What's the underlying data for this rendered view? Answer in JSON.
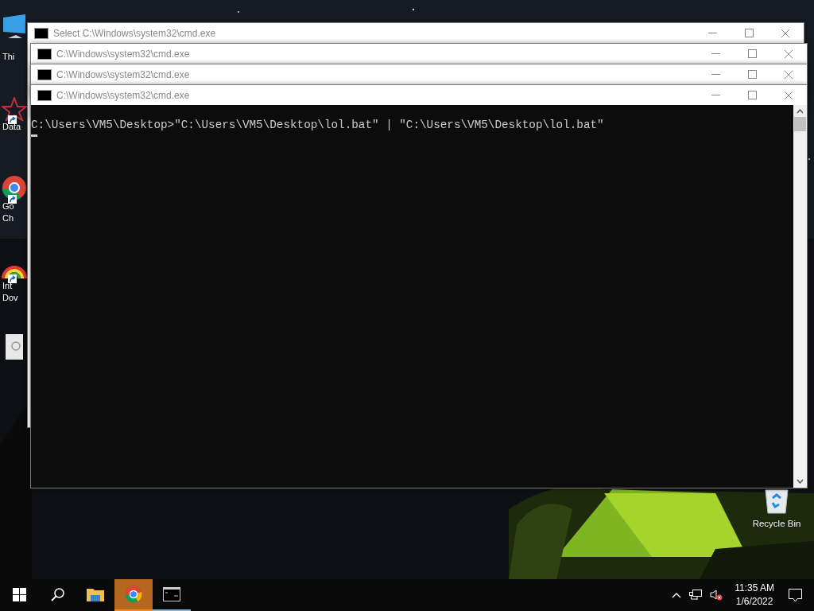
{
  "desktop_icons": [
    {
      "kind": "computer",
      "lines": [
        "Thi"
      ]
    },
    {
      "kind": "app",
      "lines": [
        "Data"
      ]
    },
    {
      "kind": "browser",
      "lines": [
        "Go",
        "Ch"
      ]
    },
    {
      "kind": "download",
      "lines": [
        "Int",
        "Dov"
      ]
    },
    {
      "kind": "document"
    },
    {
      "kind": "recycle",
      "lines": [
        "Recycle Bin"
      ]
    }
  ],
  "windows": [
    {
      "title": "Select C:\\Windows\\system32\\cmd.exe"
    },
    {
      "title": "C:\\Windows\\system32\\cmd.exe"
    },
    {
      "title": "C:\\Windows\\system32\\cmd.exe"
    },
    {
      "title": "C:\\Windows\\system32\\cmd.exe"
    }
  ],
  "console": {
    "lines": [
      "C:\\Users\\VM5\\Desktop>\"C:\\Users\\VM5\\Desktop\\lol.bat\" | \"C:\\Users\\VM5\\Desktop\\lol.bat\""
    ]
  },
  "taskbar": {
    "items": [
      {
        "kind": "start",
        "flashing": false,
        "running": false
      },
      {
        "kind": "search",
        "flashing": false,
        "running": false
      },
      {
        "kind": "explorer",
        "flashing": false,
        "running": false
      },
      {
        "kind": "chrome",
        "flashing": true,
        "running": true
      },
      {
        "kind": "console",
        "flashing": false,
        "running": true
      }
    ],
    "time": "11:35 AM",
    "date": "1/6/2022"
  }
}
